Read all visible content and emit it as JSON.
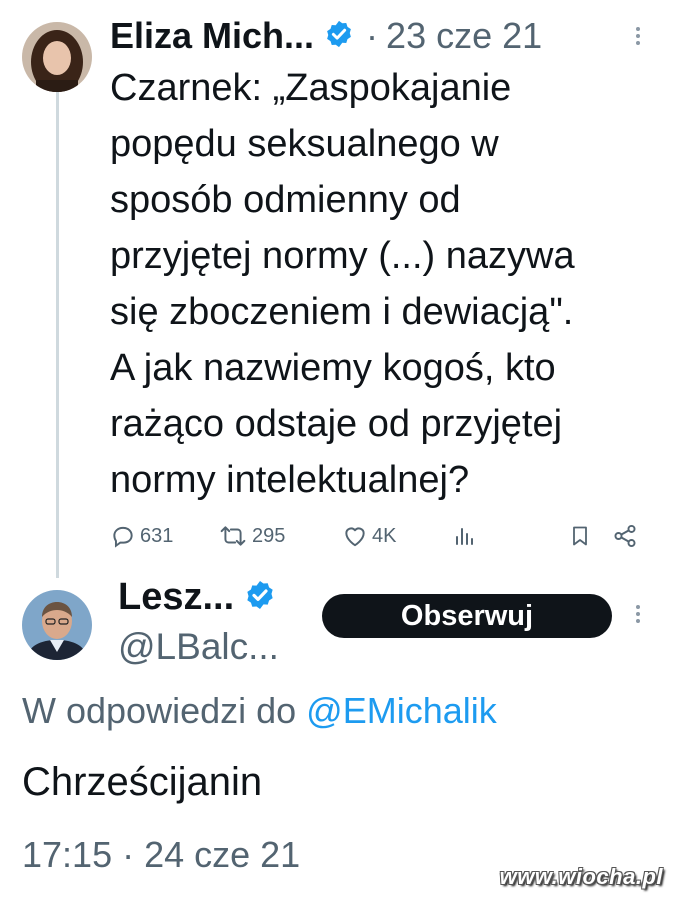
{
  "tweet1": {
    "author_name": "Eliza Mich...",
    "separator": "·",
    "date": "23 cze 21",
    "text": "Czarnek: „Zaspokajanie\npopędu seksualnego w\nsposób odmienny od\nprzyjętej normy (...) nazywa\nsię zboczeniem i dewiacją\".\nA jak nazwiemy kogoś, kto\nrażąco odstaje od przyjętej\nnormy intelektualnej?",
    "actions": {
      "replies": "631",
      "retweets": "295",
      "likes": "4K"
    }
  },
  "tweet2": {
    "author_name": "Lesz...",
    "handle": "@LBalc...",
    "follow_label": "Obserwuj",
    "reply_prefix": "W odpowiedzi do",
    "reply_mention": "@EMichalik",
    "text": "Chrześcijanin",
    "time": "17:15",
    "separator": "·",
    "date": "24 cze 21"
  },
  "watermark": "www.wiocha.pl",
  "colors": {
    "text_primary": "#0f1419",
    "text_secondary": "#536471",
    "link": "#1d9bf0",
    "verified": "#1d9bf0",
    "thread_line": "#cfd9de",
    "follow_button": "#0f1419"
  },
  "icons": [
    "verified-badge-icon",
    "more-options-icon",
    "reply-icon",
    "retweet-icon",
    "like-icon",
    "views-icon",
    "bookmark-icon",
    "share-icon"
  ]
}
